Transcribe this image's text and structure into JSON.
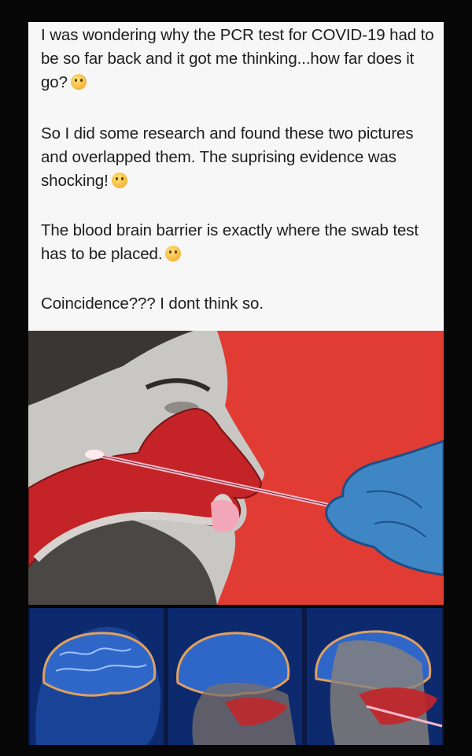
{
  "post": {
    "paragraph1": "I was wondering why the PCR test for COVID-19 had to be so far back and it got me thinking...how far does it go?",
    "paragraph2": "So I  did some research and found these two pictures and overlapped them. The suprising evidence was shocking!",
    "paragraph3": "The blood brain barrier is exactly where the swab test has to be placed.",
    "paragraph4": "Coincidence??? I dont think so."
  },
  "emojis": {
    "p1": "thinking-face-emoji",
    "p2": "astonished-face-emoji",
    "p3": "worried-face-emoji"
  },
  "colors": {
    "page_background": "#060606",
    "card_background": "#f7f7f7",
    "text": "#1d1d1d",
    "illustration_background": "#e03c33",
    "nasal_cavity": "#c42428",
    "glove": "#3f86c5",
    "swab": "#f4b8c8",
    "brain_blue": "#2f67c8"
  }
}
